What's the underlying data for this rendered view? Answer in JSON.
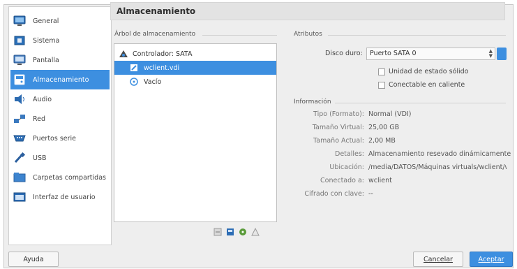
{
  "header": {
    "title": "Almacenamiento"
  },
  "sidebar": {
    "items": [
      {
        "label": "General",
        "icon": "monitor-icon"
      },
      {
        "label": "Sistema",
        "icon": "chip-icon"
      },
      {
        "label": "Pantalla",
        "icon": "display-icon"
      },
      {
        "label": "Almacenamiento",
        "icon": "storage-icon",
        "active": true
      },
      {
        "label": "Audio",
        "icon": "speaker-icon"
      },
      {
        "label": "Red",
        "icon": "network-icon"
      },
      {
        "label": "Puertos serie",
        "icon": "serial-port-icon"
      },
      {
        "label": "USB",
        "icon": "usb-icon"
      },
      {
        "label": "Carpetas compartidas",
        "icon": "shared-folder-icon"
      },
      {
        "label": "Interfaz de usuario",
        "icon": "user-interface-icon"
      }
    ]
  },
  "storage_tree": {
    "title": "Árbol de almacenamiento",
    "controller": "Controlador: SATA",
    "items": [
      {
        "label": "wclient.vdi",
        "selected": true
      },
      {
        "label": "Vacío"
      }
    ]
  },
  "attributes": {
    "title": "Atributos",
    "disk_label": "Disco duro:",
    "disk_value": "Puerto SATA 0",
    "ssd_label": "Unidad de estado sólido",
    "hotplug_label": "Conectable en caliente"
  },
  "information": {
    "title": "Información",
    "rows": [
      {
        "key": "Tipo (Formato):",
        "value": "Normal (VDI)"
      },
      {
        "key": "Tamaño Virtual:",
        "value": "25,00 GB"
      },
      {
        "key": "Tamaño Actual:",
        "value": "2,00 MB"
      },
      {
        "key": "Detalles:",
        "value": "Almacenamiento resevado dinámicamente"
      },
      {
        "key": "Ubicación:",
        "value": "/media/DATOS/Máquinas virtuals/wclient/wc"
      },
      {
        "key": "Conectado a:",
        "value": "wclient"
      },
      {
        "key": "Cifrado con clave:",
        "value": "--"
      }
    ]
  },
  "buttons": {
    "help": "Ayuda",
    "cancel": "Cancelar",
    "accept": "Aceptar"
  },
  "colors": {
    "accent": "#3d8fe0"
  }
}
